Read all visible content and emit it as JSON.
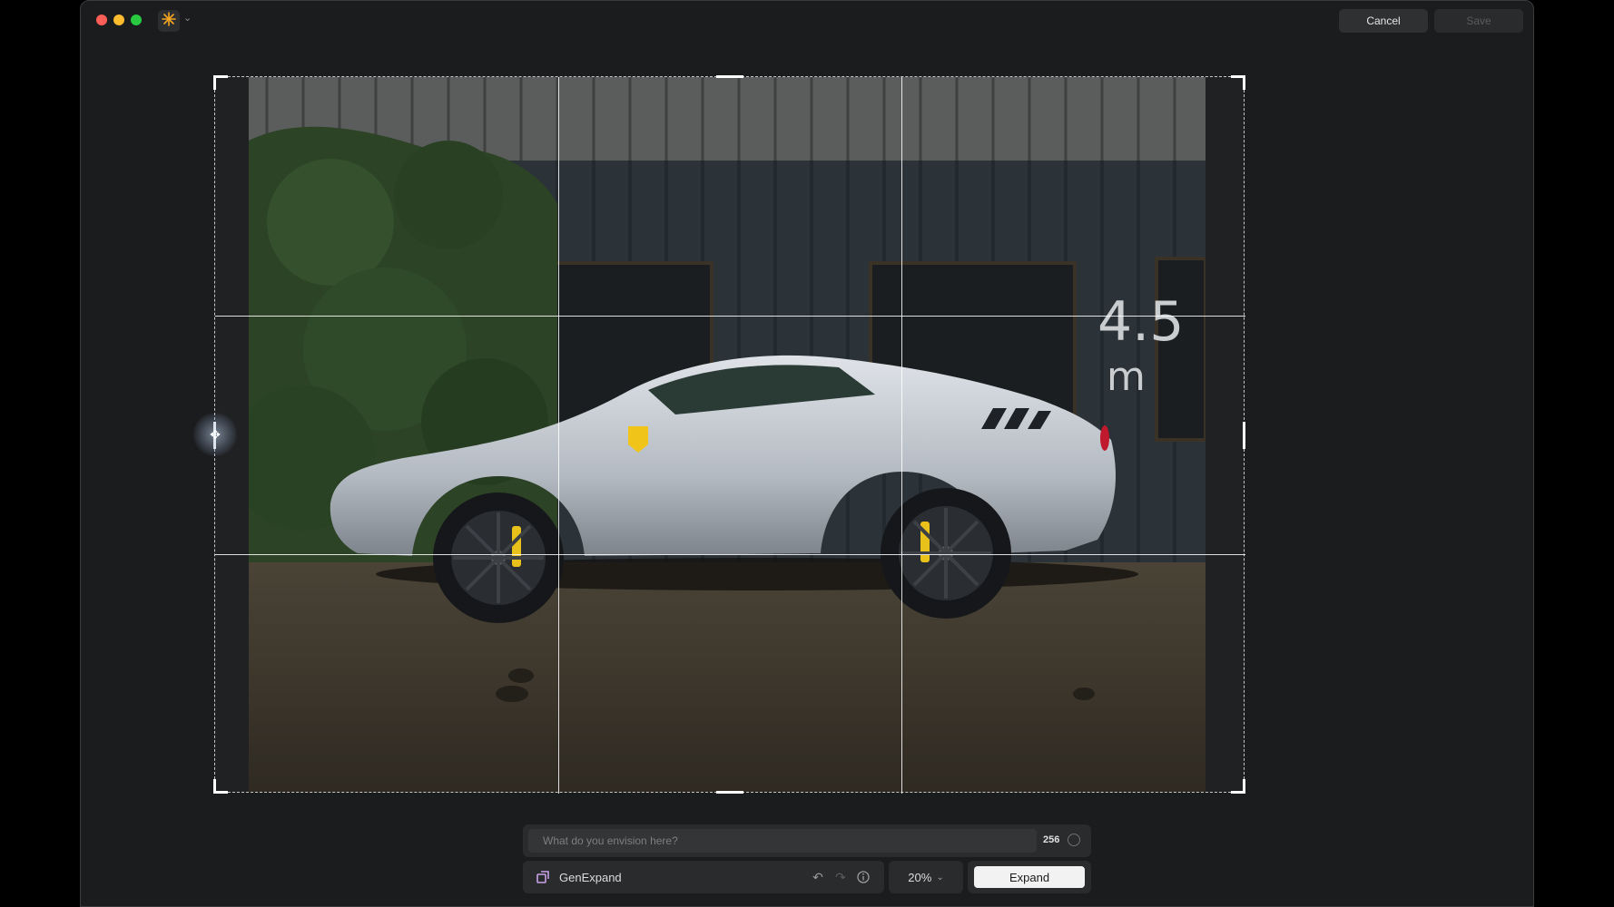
{
  "window": {
    "cancel_label": "Cancel",
    "save_label": "Save"
  },
  "prompt": {
    "placeholder": "What do you envision here?",
    "value": "",
    "char_count": "256"
  },
  "toolbar": {
    "tool_label": "GenExpand",
    "zoom_label": "20%",
    "expand_label": "Expand"
  },
  "icons": {
    "app": "sparkle-icon",
    "tool": "gen-expand-icon",
    "undo": "undo-icon",
    "redo": "redo-icon",
    "info": "info-icon",
    "zoom_dropdown": "chevron-down-icon"
  },
  "colors": {
    "accent_orange": "#f5a623",
    "tool_icon": "#c9a2e8",
    "expand_button_bg": "#f2f2f2"
  }
}
